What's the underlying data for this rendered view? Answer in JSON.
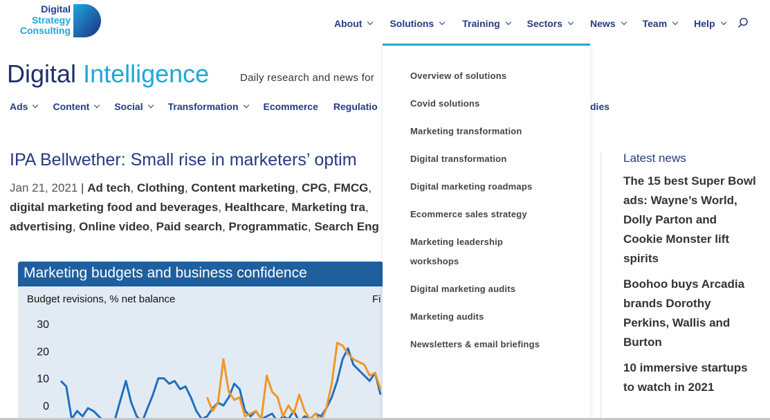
{
  "logo": {
    "lines": [
      "Digital",
      "Strategy",
      "Consulting"
    ],
    "color_dark": "#1c3d8f",
    "color_light": "#1fa7d9"
  },
  "topnav": [
    {
      "label": "About",
      "dropdown": true
    },
    {
      "label": "Solutions",
      "dropdown": true
    },
    {
      "label": "Training",
      "dropdown": true
    },
    {
      "label": "Sectors",
      "dropdown": true
    },
    {
      "label": "News",
      "dropdown": true
    },
    {
      "label": "Team",
      "dropdown": true
    },
    {
      "label": "Help",
      "dropdown": true
    }
  ],
  "search_icon": "search-icon",
  "brand": {
    "word1": "Digital",
    "word2": "Intelligence",
    "tagline": "Daily research and news for"
  },
  "subnav": [
    {
      "label": "Ads",
      "dropdown": true
    },
    {
      "label": "Content",
      "dropdown": true
    },
    {
      "label": "Social",
      "dropdown": true
    },
    {
      "label": "Transformation",
      "dropdown": true
    },
    {
      "label": "Ecommerce",
      "dropdown": false
    },
    {
      "label": "Regulatio",
      "dropdown": false
    }
  ],
  "subnav_tail": "dies",
  "article": {
    "title": "IPA Bellwether: Small rise in marketers’ optim",
    "date": "Jan 21, 2021",
    "separator": " | ",
    "tags": [
      "Ad tech",
      "Clothing",
      "Content marketing",
      "CPG",
      "FMCG",
      "digital marketing food and beverages",
      "Healthcare",
      "Marketing tra",
      "advertising",
      "Online video",
      "Paid search",
      "Programmatic",
      "Search Eng"
    ]
  },
  "chart": {
    "title": "Marketing budgets and business confidence",
    "subtitle": "Budget revisions, % net balance",
    "subtitle_right": "Fi",
    "colors": {
      "header": "#1f5f9e",
      "background": "#e2ebf4",
      "series_a": "#1f6fbf",
      "series_b": "#f0962a"
    }
  },
  "chart_data": {
    "type": "line",
    "title": "Marketing budgets and business confidence",
    "ylabel": "Budget revisions, % net balance",
    "yticks": [
      "30",
      "20",
      "10",
      "0"
    ],
    "ylim": [
      -5,
      30
    ],
    "series": [
      {
        "values": [
          9,
          7,
          -5,
          -2,
          -4,
          -1,
          -2,
          -4,
          -6,
          -8,
          -5,
          2,
          9,
          1,
          -4,
          -6,
          -1,
          4,
          10,
          10,
          8,
          9,
          6,
          7,
          3,
          -2,
          -5,
          -4,
          -1,
          1,
          0,
          3,
          8,
          6,
          -2,
          -4,
          -2,
          -5,
          -4,
          -3,
          -6,
          -4,
          -5,
          -2,
          -6,
          -4,
          -5,
          -3,
          -4,
          -1,
          3,
          9,
          17,
          21,
          15,
          13,
          11,
          9,
          12,
          4
        ]
      },
      {
        "values": [
          null,
          null,
          null,
          null,
          null,
          null,
          null,
          null,
          null,
          null,
          null,
          null,
          null,
          null,
          null,
          null,
          null,
          null,
          null,
          null,
          null,
          null,
          null,
          null,
          null,
          null,
          null,
          3,
          -2,
          1,
          17,
          5,
          2,
          3,
          -4,
          -3,
          -2,
          -5,
          11,
          5,
          3,
          -4,
          0,
          -3,
          4,
          -2,
          -5,
          -3,
          -6,
          -1,
          8,
          23,
          22,
          19,
          17,
          16,
          15,
          11,
          12,
          6
        ]
      }
    ]
  },
  "latest_news": {
    "title": "Latest news",
    "items": [
      "The 15 best Super Bowl ads: Wayne’s World, Dolly Parton and Cookie Monster lift spirits",
      "Boohoo buys Arcadia brands Dorothy Perkins, Wallis and Burton",
      "10 immersive startups to watch in 2021"
    ]
  },
  "solutions_dropdown": {
    "items": [
      "Overview of solutions",
      "Covid solutions",
      "Marketing transformation",
      "Digital transformation",
      "Digital marketing roadmaps",
      "Ecommerce sales strategy",
      "Marketing leadership workshops",
      "Digital marketing audits",
      "Marketing audits",
      "Newsletters & email briefings"
    ],
    "accent": "#1fa7d9"
  }
}
